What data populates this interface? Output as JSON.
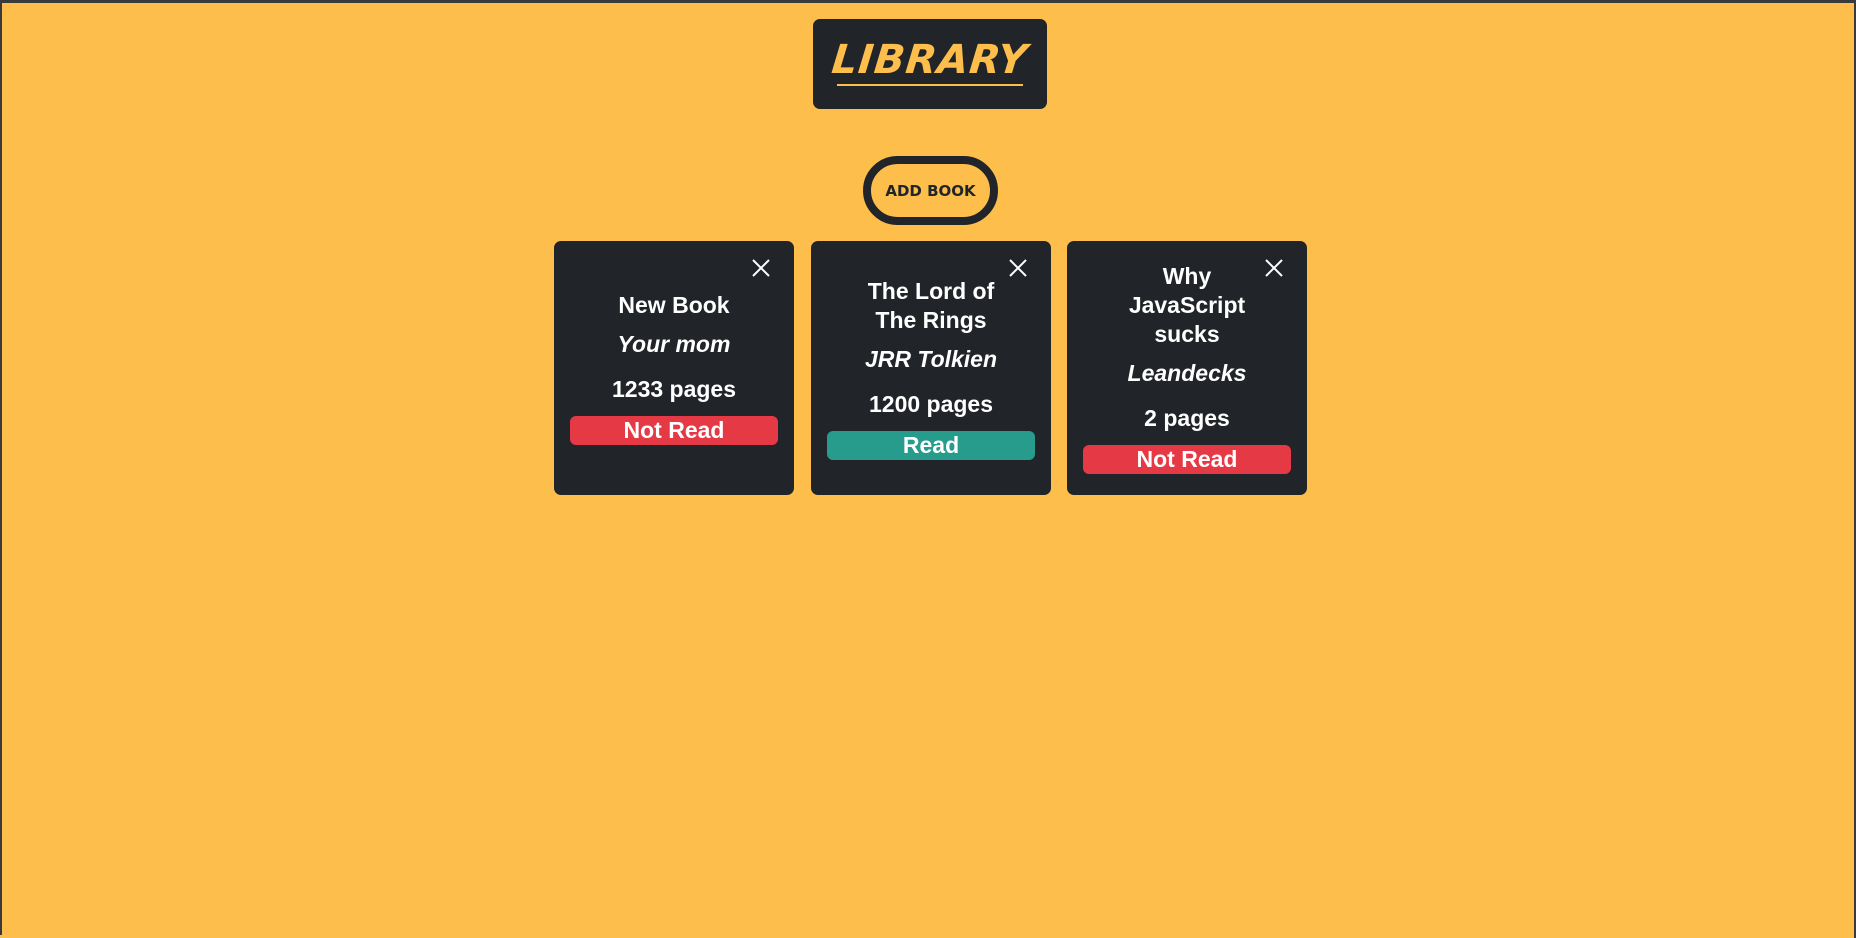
{
  "header": {
    "logo_text": "LIBRARY"
  },
  "add_button": {
    "label": "ADD BOOK"
  },
  "colors": {
    "background": "#fdbe4b",
    "card": "#212429",
    "read": "#279c8c",
    "not_read": "#e63946"
  },
  "books": [
    {
      "title": "New Book",
      "author": "Your mom",
      "pages": "1233 pages",
      "status": "Not Read",
      "read": false
    },
    {
      "title": "The Lord of The Rings",
      "author": "JRR Tolkien",
      "pages": "1200 pages",
      "status": "Read",
      "read": true
    },
    {
      "title": "Why JavaScript sucks",
      "author": "Leandecks",
      "pages": "2 pages",
      "status": "Not Read",
      "read": false
    }
  ]
}
